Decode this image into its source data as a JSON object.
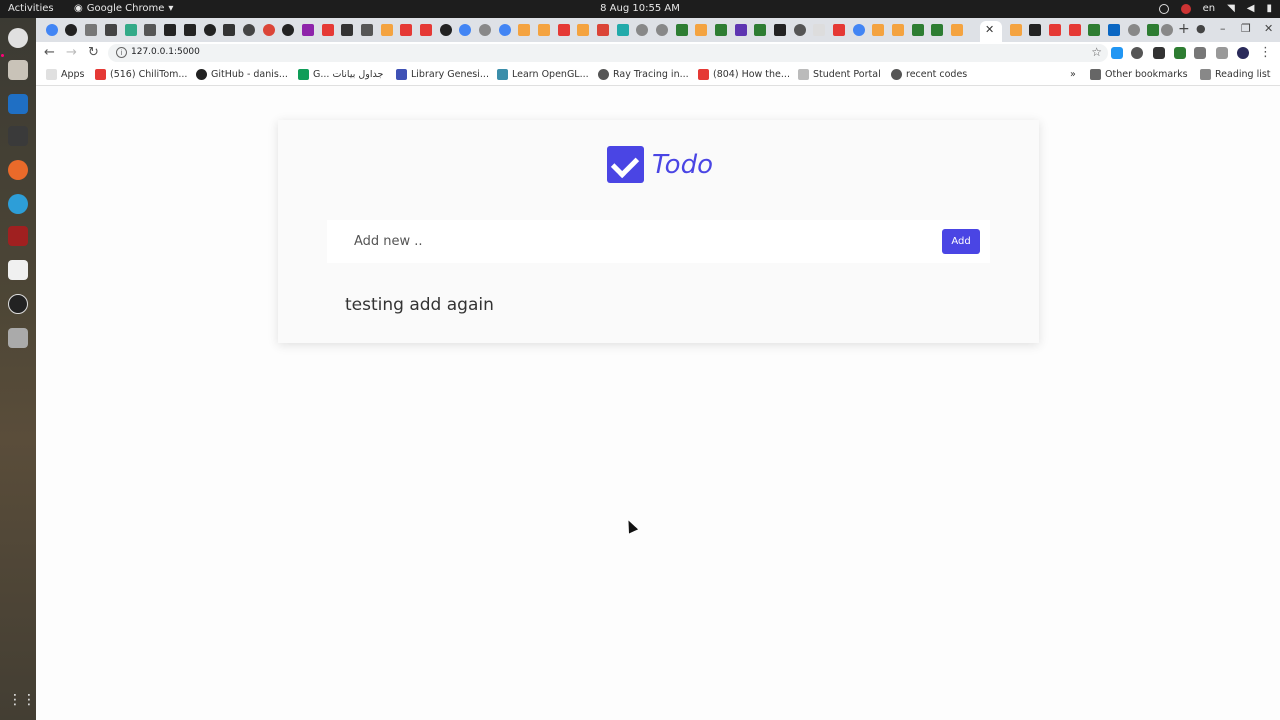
{
  "system_bar": {
    "activities": "Activities",
    "app_name": "Google Chrome",
    "clock": "8 Aug  10:55 AM",
    "language": "en"
  },
  "browser": {
    "url": "127.0.0.1:5000",
    "bookmarks": [
      {
        "label": "Apps"
      },
      {
        "label": "(516) ChiliTom..."
      },
      {
        "label": "GitHub - danis..."
      },
      {
        "label": "G... جداول بيانات"
      },
      {
        "label": "Library Genesi..."
      },
      {
        "label": "Learn OpenGL..."
      },
      {
        "label": "Ray Tracing in..."
      },
      {
        "label": "(804) How the..."
      },
      {
        "label": "Student Portal"
      },
      {
        "label": "recent codes"
      }
    ],
    "other_bookmarks": "Other bookmarks",
    "reading_list": "Reading list"
  },
  "app": {
    "title": "Todo",
    "input_placeholder": "Add new ..",
    "add_button": "Add",
    "todos": [
      "testing add again"
    ],
    "accent_color": "#4a45e4"
  }
}
